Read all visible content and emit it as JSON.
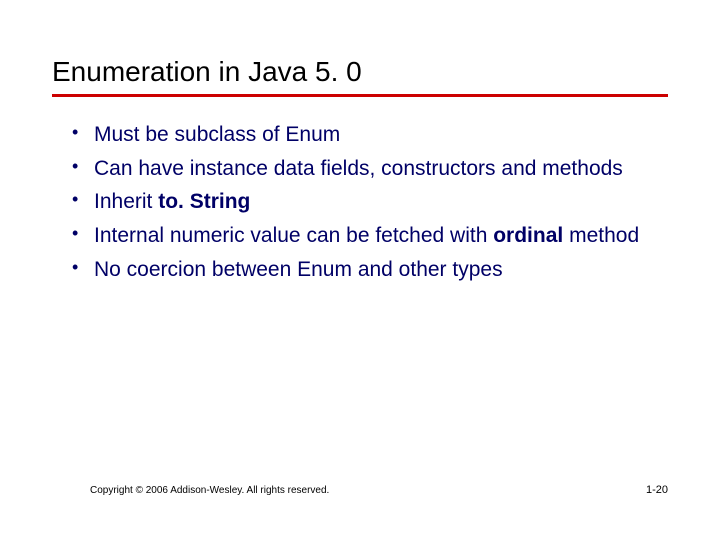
{
  "slide": {
    "title": "Enumeration in Java 5. 0",
    "bullets": [
      {
        "text": "Must be subclass of Enum"
      },
      {
        "pre": "Can have instance data fields, constructors and methods"
      },
      {
        "pre": "Inherit ",
        "bold": "to. String"
      },
      {
        "pre": "Internal numeric value can be fetched with ",
        "bold": "ordinal",
        "post": " method"
      },
      {
        "text": "No coercion between Enum and other types"
      }
    ],
    "footer": {
      "copyright": "Copyright © 2006 Addison-Wesley. All rights reserved.",
      "page": "1-20"
    }
  }
}
